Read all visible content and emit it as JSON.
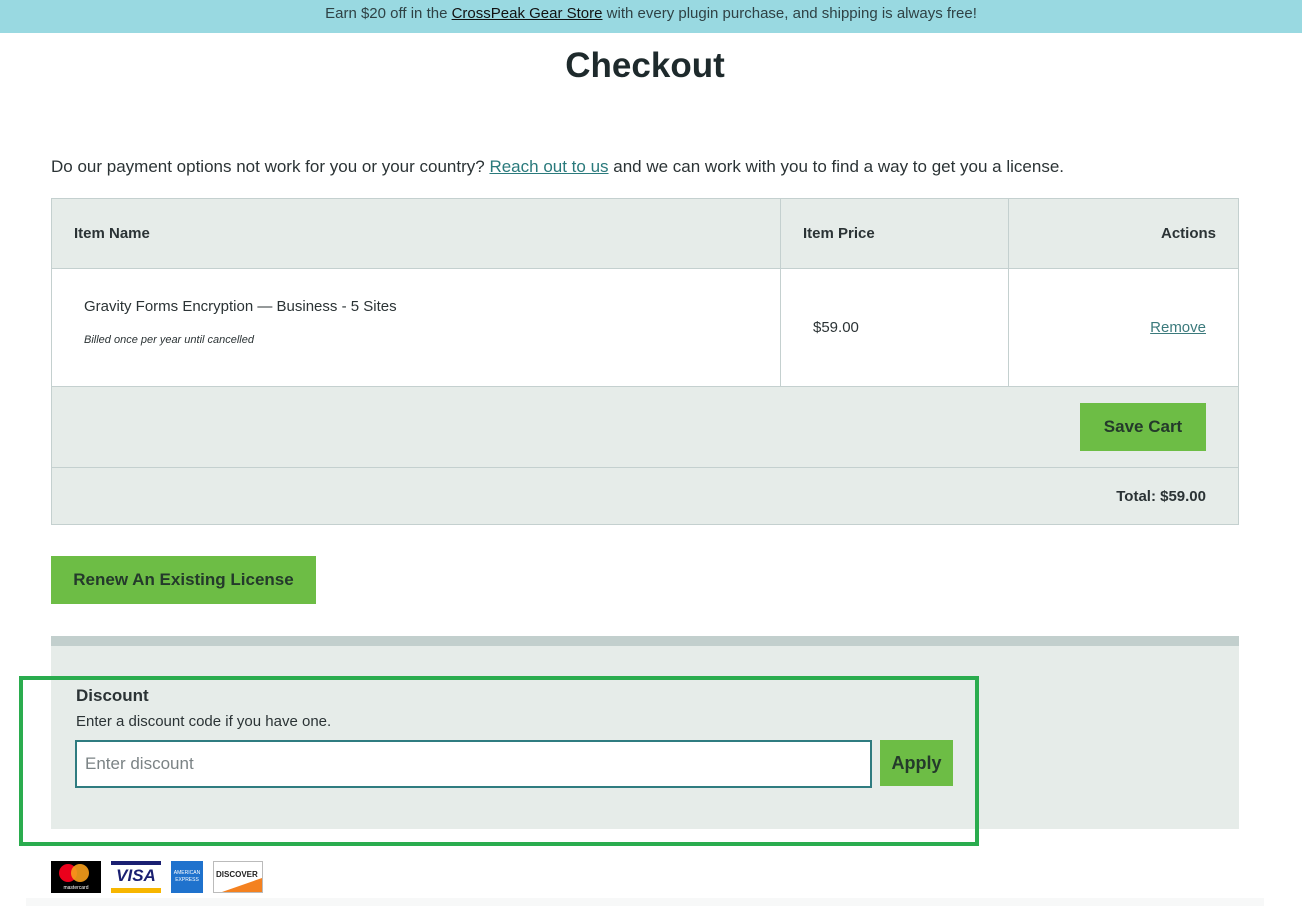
{
  "promo": {
    "text_before": "Earn $20 off in the ",
    "link": "CrossPeak Gear Store",
    "text_after": " with every plugin purchase, and shipping is always free!"
  },
  "page": {
    "title": "Checkout"
  },
  "intro": {
    "text_before": "Do our payment options not work for you or your country? ",
    "link": "Reach out to us",
    "text_after": " and we can work with you to find a way to get you a license."
  },
  "cart": {
    "columns": {
      "name": "Item Name",
      "price": "Item Price",
      "actions": "Actions"
    },
    "items": [
      {
        "name": "Gravity Forms Encryption — Business - 5 Sites",
        "billing": "Billed once per year until cancelled",
        "price": "$59.00",
        "action": "Remove"
      }
    ],
    "save_label": "Save Cart",
    "total_label": "Total: $59.00"
  },
  "renew": {
    "label": "Renew An Existing License"
  },
  "discount": {
    "label": "Discount",
    "help": "Enter a discount code if you have one.",
    "value": "",
    "placeholder": "Enter discount",
    "apply_label": "Apply"
  },
  "payment_cards": [
    {
      "name": "mastercard",
      "label": "mastercard"
    },
    {
      "name": "visa",
      "label": "VISA"
    },
    {
      "name": "american-express",
      "label": "AMERICAN EXPRESS"
    },
    {
      "name": "discover",
      "label": "DISCOVER"
    }
  ],
  "colors": {
    "promo_bg": "#99d9e1",
    "accent_green": "#6dbd45",
    "link_teal": "#2a7a7c",
    "panel_bg": "#e6ece9",
    "highlight": "#2aac4e"
  }
}
